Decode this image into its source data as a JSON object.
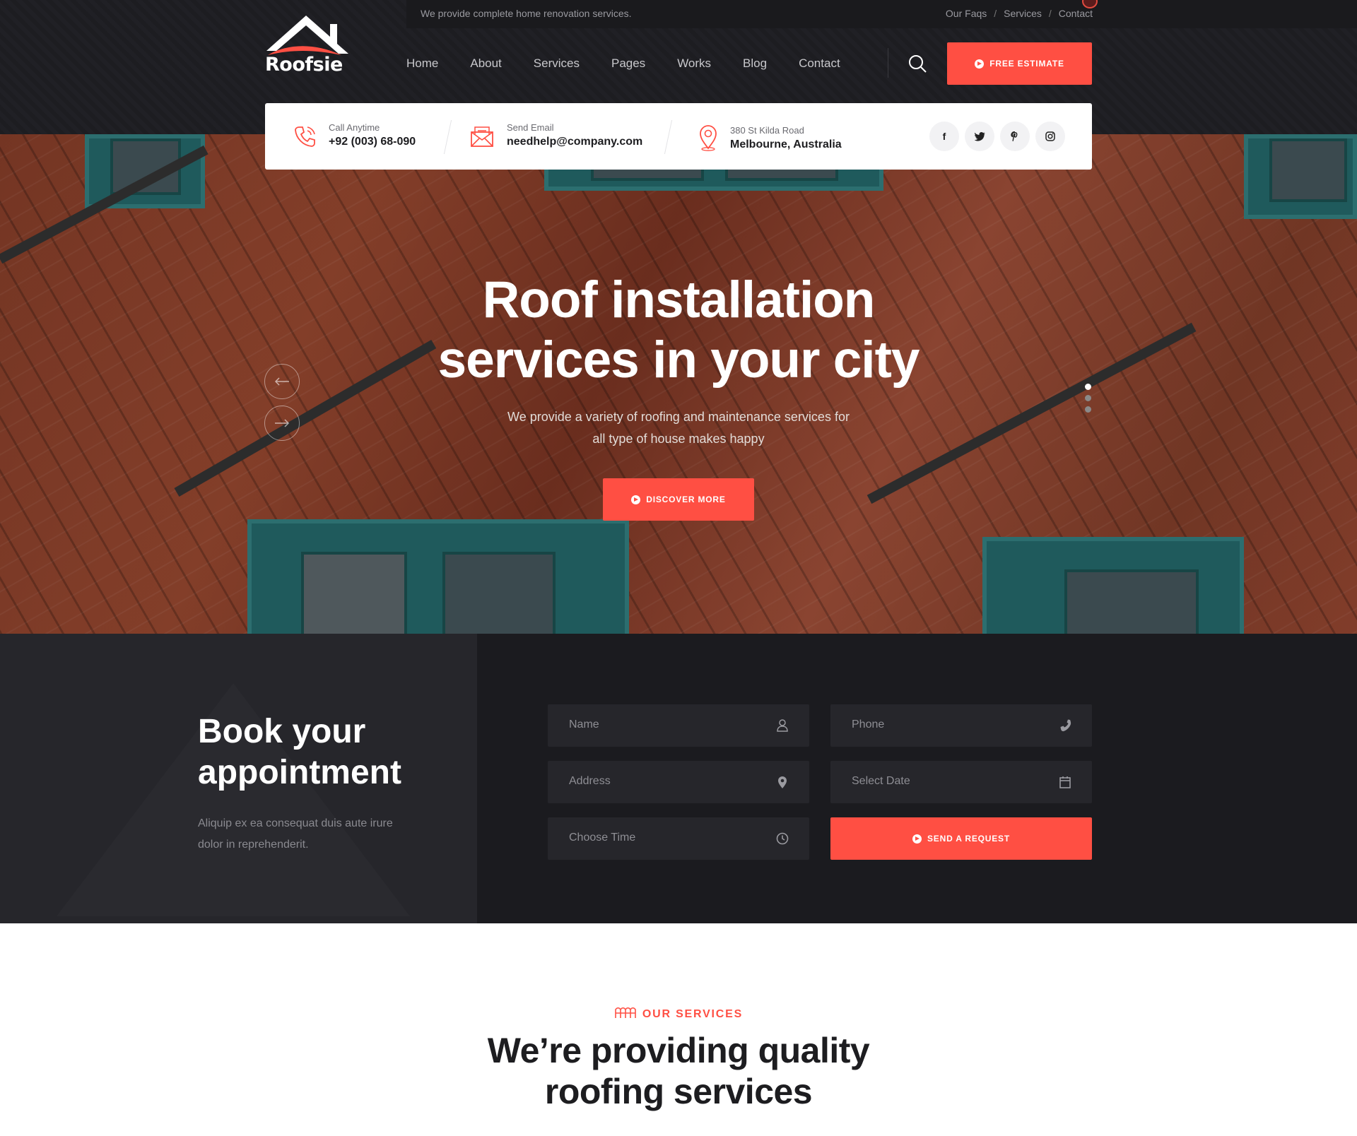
{
  "topbar": {
    "tagline": "We provide complete home renovation services.",
    "links": [
      "Our Faqs",
      "Services",
      "Contact"
    ]
  },
  "brand": {
    "name": "Roofsie",
    "accent": "#ff4f43",
    "dark": "#1b1b1f"
  },
  "nav": {
    "items": [
      "Home",
      "About",
      "Services",
      "Pages",
      "Works",
      "Blog",
      "Contact"
    ],
    "cta": "FREE ESTIMATE",
    "search_icon": "search-icon"
  },
  "contact": {
    "phone": {
      "label": "Call Anytime",
      "value": "+92 (003) 68-090",
      "icon": "phone-icon"
    },
    "email": {
      "label": "Send Email",
      "value": "needhelp@company.com",
      "icon": "mail-icon"
    },
    "address": {
      "label": "380 St Kilda Road",
      "value": "Melbourne, Australia",
      "icon": "location-pin-icon"
    },
    "social": [
      "facebook-icon",
      "twitter-icon",
      "pinterest-icon",
      "instagram-icon"
    ]
  },
  "hero": {
    "title_line1": "Roof installation",
    "title_line2": "services in your city",
    "subtitle_line1": "We provide a variety of roofing and maintenance services for",
    "subtitle_line2": "all type of house makes happy",
    "cta": "DISCOVER MORE",
    "slides_total": 3,
    "slide_active": 1
  },
  "appointment": {
    "title_line1": "Book your",
    "title_line2": "appointment",
    "text": "Aliquip ex ea consequat duis aute irure dolor in reprehenderit.",
    "fields": {
      "name": "Name",
      "phone": "Phone",
      "address": "Address",
      "date": "Select Date",
      "time": "Choose Time"
    },
    "submit": "SEND A REQUEST"
  },
  "services": {
    "label": "OUR SERVICES",
    "title_line1": "We’re providing quality",
    "title_line2": "roofing services"
  }
}
